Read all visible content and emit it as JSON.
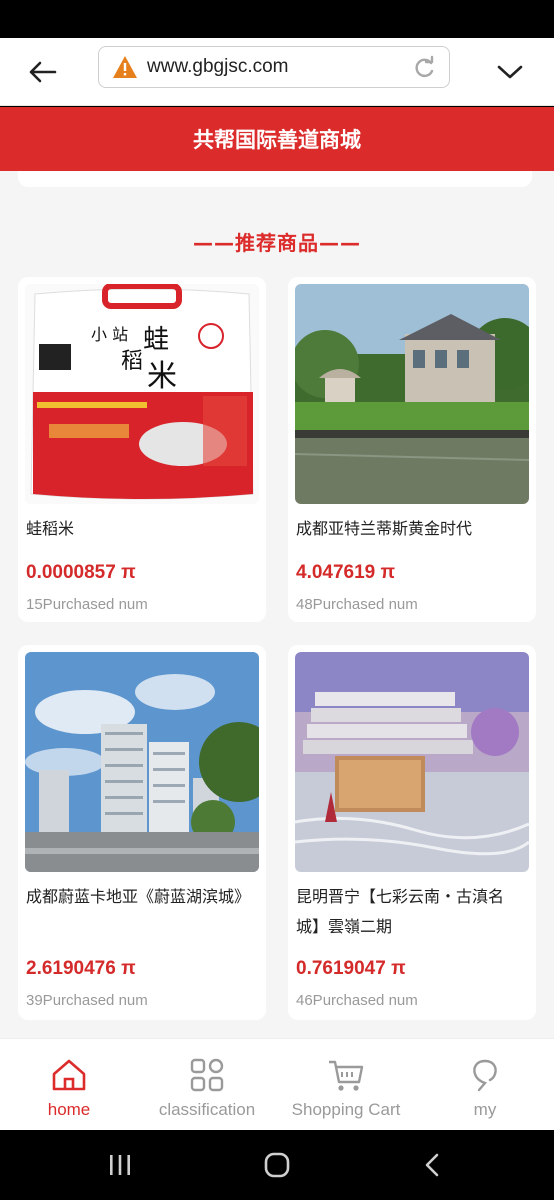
{
  "browser": {
    "url": "www.gbgjsc.com"
  },
  "header": {
    "title": "共帮国际善道商城"
  },
  "section": {
    "title": "——推荐商品——"
  },
  "products": [
    {
      "name": "蛙稻米",
      "price": "0.0000857 π",
      "sold": "15Purchased num"
    },
    {
      "name": "成都亚特兰蒂斯黄金时代",
      "price": "4.047619 π",
      "sold": "48Purchased num"
    },
    {
      "name": "成都蔚蓝卡地亚《蔚蓝湖滨城》",
      "price": "2.6190476 π",
      "sold": "39Purchased num"
    },
    {
      "name": "昆明晋宁【七彩云南・古滇名城】雲嶺二期",
      "price": "0.7619047 π",
      "sold": "46Purchased num"
    }
  ],
  "tabbar": {
    "items": [
      {
        "label": "home",
        "icon": "home-icon",
        "active": true
      },
      {
        "label": "classification",
        "icon": "grid-icon",
        "active": false
      },
      {
        "label": "Shopping Cart",
        "icon": "cart-icon",
        "active": false
      },
      {
        "label": "my",
        "icon": "user-icon",
        "active": false
      }
    ]
  },
  "colors": {
    "accent": "#dc2b2b",
    "background": "#f5f5f5",
    "muted_text": "#999999"
  }
}
